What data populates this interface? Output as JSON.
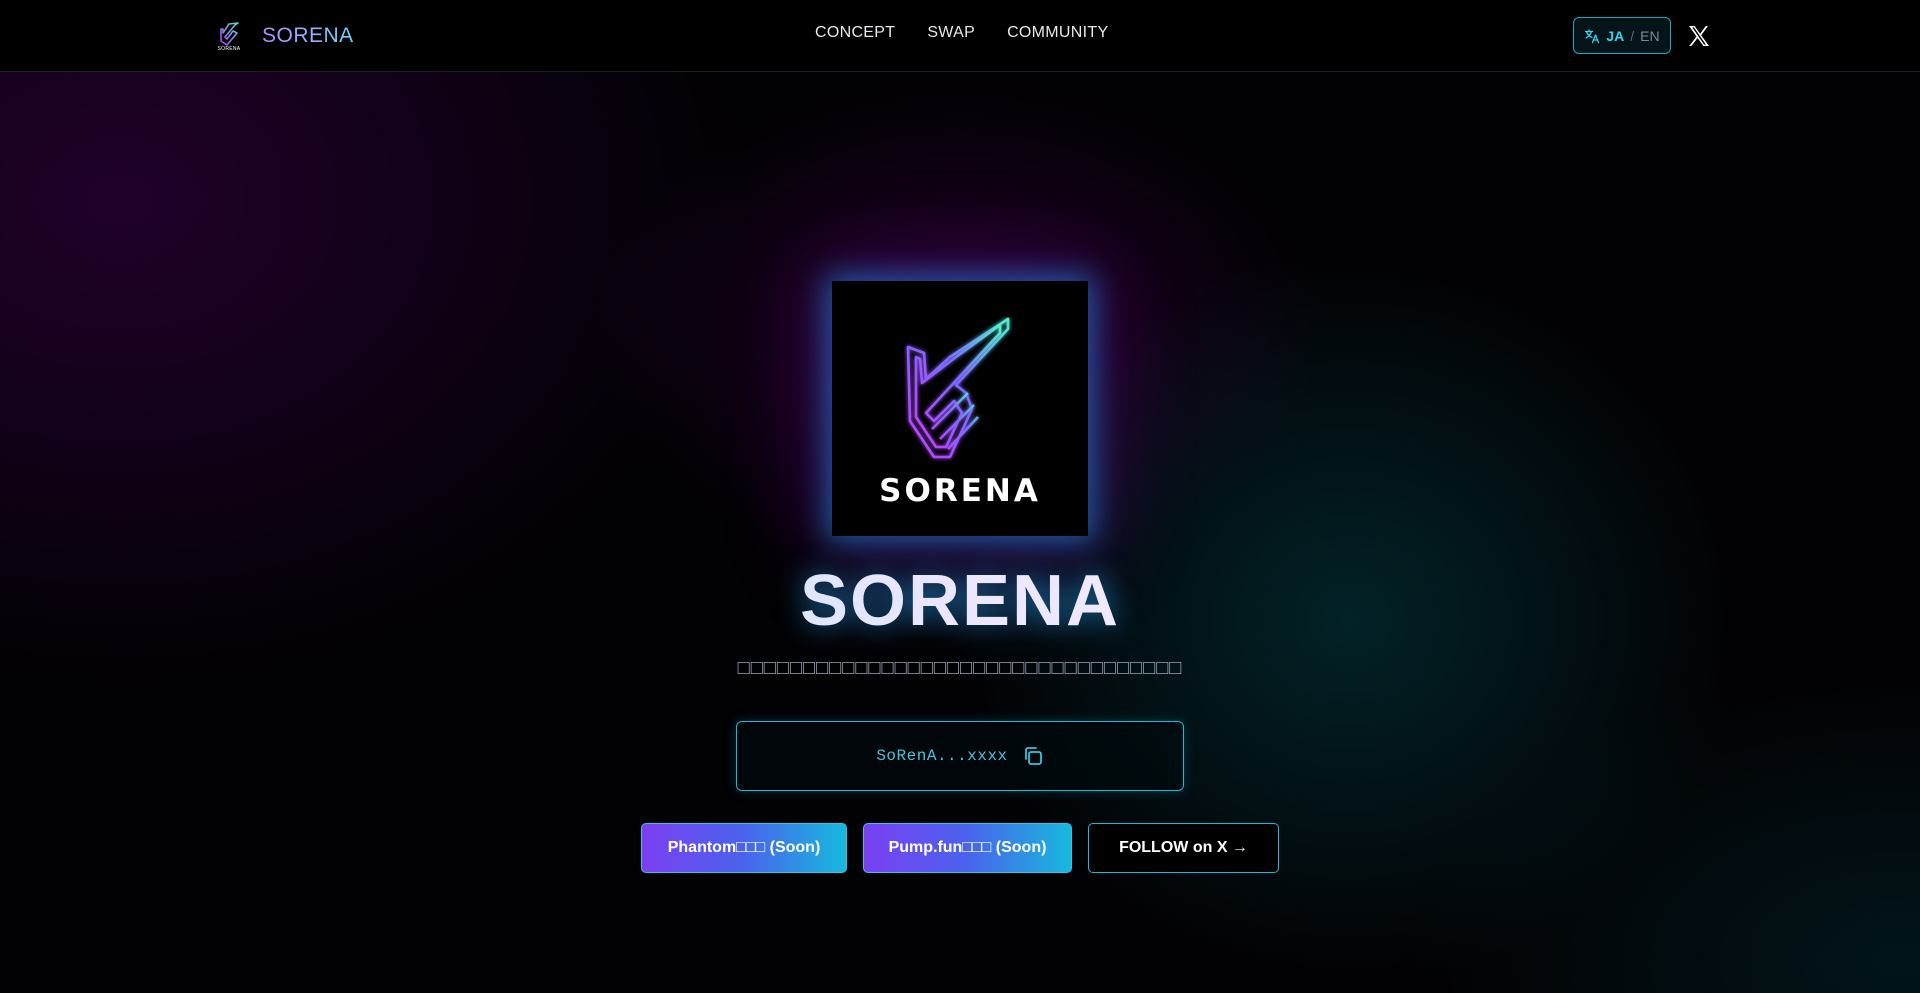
{
  "header": {
    "brand_name": "SORENA",
    "brand_logo_word": "SORENA",
    "nav": [
      {
        "label": "CONCEPT"
      },
      {
        "label": "SWAP"
      },
      {
        "label": "COMMUNITY"
      }
    ],
    "language": {
      "active": "JA",
      "separator": "/",
      "inactive": "EN"
    }
  },
  "hero": {
    "logo_word": "SORENA",
    "title": "SORENA",
    "subtitle": "□□□□□□□□□□□□□□□□□□□□□□□□□□□□□□□□□□",
    "contract_address": "SoRenA...xxxx",
    "buttons": {
      "phantom": "Phantom□□□ (Soon)",
      "pump": "Pump.fun□□□ (Soon)",
      "follow": "FOLLOW on X →"
    }
  },
  "colors": {
    "accent_cyan": "#1fb9d6",
    "accent_purple": "#7b3ff2",
    "background": "#000000"
  },
  "icons": {
    "language": "translate-icon",
    "social": "x-logo-icon",
    "copy": "copy-icon"
  }
}
